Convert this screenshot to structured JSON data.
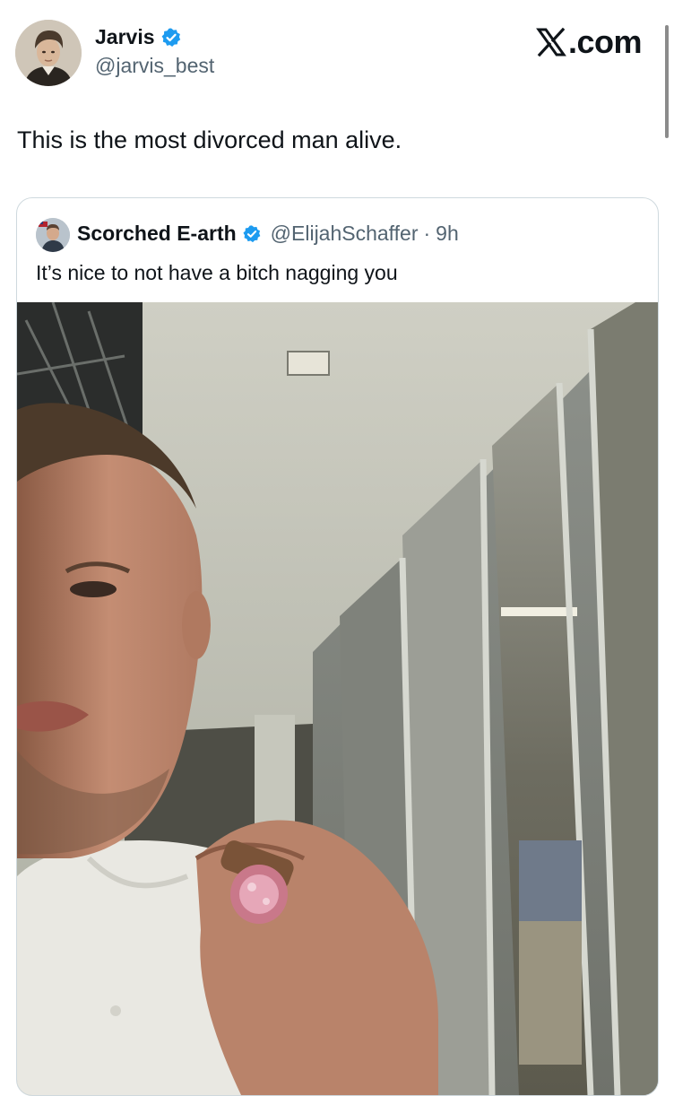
{
  "author": {
    "display_name": "Jarvis",
    "handle": "@jarvis_best",
    "verified": true
  },
  "brand": {
    "logo_text": ".com"
  },
  "tweet": {
    "text": "This is the most divorced man alive."
  },
  "quoted_tweet": {
    "display_name": "Scorched E-arth",
    "handle": "@ElijahSchaffer",
    "separator": "·",
    "time": "9h",
    "text": "It’s nice to not have a bitch nagging you",
    "verified": true
  },
  "colors": {
    "verified_blue": "#1d9bf0",
    "text_primary": "#0f1419",
    "text_secondary": "#536471",
    "border": "#cfd9de"
  }
}
